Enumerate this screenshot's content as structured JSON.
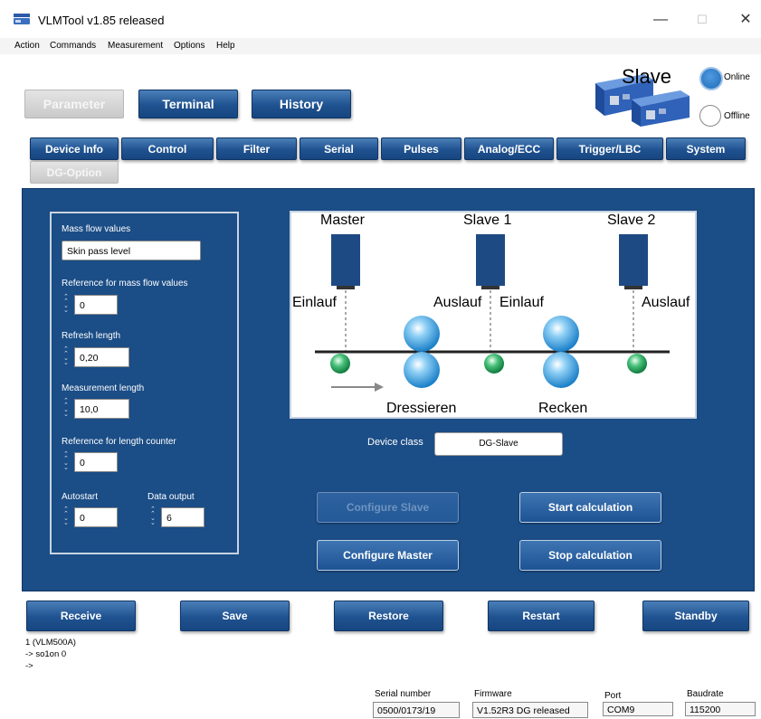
{
  "window": {
    "title": "VLMTool  v1.85 released",
    "minimize": "—",
    "maximize": "☐",
    "close": "✕"
  },
  "menu": [
    "Action",
    "Commands",
    "Measurement",
    "Options",
    "Help"
  ],
  "top_buttons": {
    "parameter": "Parameter",
    "terminal": "Terminal",
    "history": "History"
  },
  "device_status": {
    "label": "Slave",
    "online": "Online",
    "offline": "Offline",
    "selected": "Online"
  },
  "tabs": [
    "Device Info",
    "Control",
    "Filter",
    "Serial",
    "Pulses",
    "Analog/ECC",
    "Trigger/LBC",
    "System"
  ],
  "tab_disabled": "DG-Option",
  "params": {
    "mass_flow_label": "Mass flow values",
    "mass_flow_value": "Skin pass level",
    "ref_mass_flow_label": "Reference for mass flow values",
    "ref_mass_flow_value": "0",
    "refresh_length_label": "Refresh length",
    "refresh_length_value": "0,20",
    "measurement_length_label": "Measurement length",
    "measurement_length_value": "10,0",
    "ref_length_counter_label": "Reference for length counter",
    "ref_length_counter_value": "0",
    "autostart_label": "Autostart",
    "autostart_value": "0",
    "data_output_label": "Data output",
    "data_output_value": "6"
  },
  "diagram": {
    "master": "Master",
    "slave1": "Slave 1",
    "slave2": "Slave 2",
    "einlauf1": "Einlauf",
    "auslauf1": "Auslauf",
    "einlauf2": "Einlauf",
    "auslauf2": "Auslauf",
    "dressieren": "Dressieren",
    "recken": "Recken"
  },
  "device_class": {
    "label": "Device class",
    "value": "DG-Slave"
  },
  "panel_buttons": {
    "configure_slave": "Configure Slave",
    "configure_master": "Configure Master",
    "start_calculation": "Start calculation",
    "stop_calculation": "Stop calculation"
  },
  "bottom_buttons": [
    "Receive",
    "Save",
    "Restore",
    "Restart",
    "Standby"
  ],
  "log": [
    "1 (VLM500A)",
    "-> so1on 0",
    "->"
  ],
  "status": {
    "serial_label": "Serial number",
    "serial_value": "0500/0173/19",
    "firmware_label": "Firmware",
    "firmware_value": "V1.52R3 DG released",
    "port_label": "Port",
    "port_value": "COM9",
    "baud_label": "Baudrate",
    "baud_value": "115200"
  },
  "colors": {
    "panel": "#1b4d86",
    "button": "#1f5290",
    "online_dot": "#2e7cc7"
  }
}
